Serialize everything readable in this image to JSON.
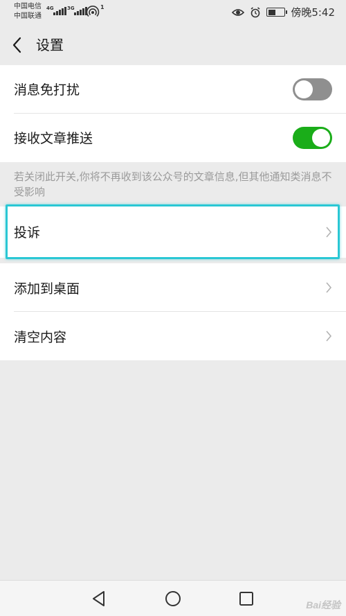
{
  "status_bar": {
    "carrier_1": "中国电信",
    "carrier_2": "中国联通",
    "net_1": "4G",
    "net_2": "3G",
    "hotspot_badge": "1",
    "time": "傍晚5:42",
    "battery_level": 0.45
  },
  "header": {
    "title": "设置"
  },
  "settings": {
    "mute_label": "消息免打扰",
    "mute_on": false,
    "push_label": "接收文章推送",
    "push_on": true,
    "hint": "若关闭此开关,你将不再收到该公众号的文章信息,但其他通知类消息不受影响",
    "complain_label": "投诉",
    "add_desktop_label": "添加到桌面",
    "clear_label": "清空内容"
  },
  "colors": {
    "toggle_on": "#1aad19",
    "toggle_off": "#8f8f8f",
    "highlight": "#2ac7d4"
  },
  "watermark": "Bai经验"
}
